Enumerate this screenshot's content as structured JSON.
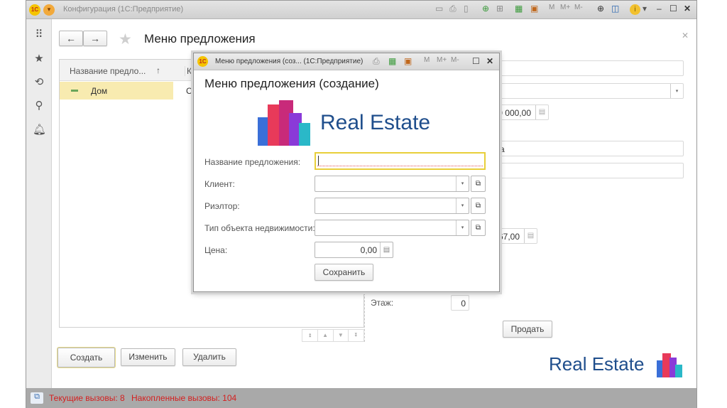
{
  "window": {
    "title": "Конфигурация  (1С:Предприятие)",
    "toolbar_icons": [
      "save-icon",
      "print-icon",
      "preview-icon",
      "add-link-icon",
      "link-icon",
      "calculator-icon",
      "calendar-icon"
    ],
    "memory": [
      "M",
      "M+",
      "M-"
    ],
    "logo": "1C"
  },
  "main": {
    "title": "Меню предложения",
    "back": "←",
    "forward": "→",
    "table": {
      "columns": [
        "Название предло...",
        "Кл"
      ],
      "sort_indicator": "↑",
      "rows": [
        {
          "name": "Дом",
          "client": "Се"
        }
      ]
    },
    "buttons": {
      "create": "Создать",
      "edit": "Изменить",
      "delete": "Удалить",
      "sell": "Продать"
    },
    "right": {
      "amount1": "0 000,00",
      "text1": "а",
      "amount2": "67,00",
      "floor_label": "Этаж:",
      "floor_value": "0"
    },
    "brand": "Real Estate"
  },
  "dialog": {
    "title": "Меню предложения (соз...  (1С:Предприятие)",
    "heading": "Меню предложения (создание)",
    "brand": "Real Estate",
    "fields": {
      "name_label": "Название предложения:",
      "name_value": "",
      "client_label": "Клиент:",
      "realtor_label": "Риэлтор:",
      "type_label": "Тип объекта недвижимости:",
      "price_label": "Цена:",
      "price_value": "0,00"
    },
    "save": "Сохранить",
    "memory": [
      "M",
      "M+",
      "M-"
    ]
  },
  "status": {
    "current": "Текущие вызовы: 8",
    "accumulated": "Накопленные вызовы: 104"
  },
  "colors": {
    "brand": "#1f4e8c",
    "status_text": "#d42020",
    "selection": "#f8ebb0",
    "focus": "#e8cf3a"
  }
}
